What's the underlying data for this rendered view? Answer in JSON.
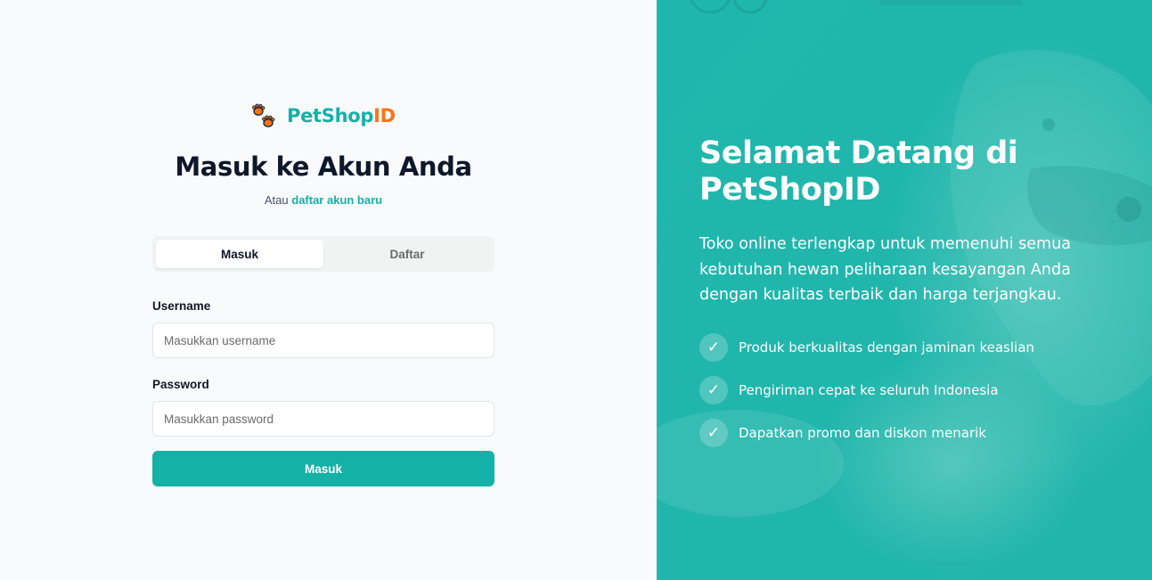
{
  "brand": {
    "name_part1": "PetShop",
    "name_part2": "ID",
    "logo_icon": "paw-prints-icon",
    "primary_color": "#14b1a7",
    "accent_color": "#f97316"
  },
  "login": {
    "title": "Masuk ke Akun Anda",
    "subtitle_prefix": "Atau",
    "subtitle_link": "daftar akun baru",
    "tabs": [
      {
        "label": "Masuk",
        "active": true
      },
      {
        "label": "Daftar",
        "active": false
      }
    ],
    "username_label": "Username",
    "username_placeholder": "Masukkan username",
    "username_value": "",
    "password_label": "Password",
    "password_placeholder": "Masukkan password",
    "password_value": "",
    "submit_label": "Masuk"
  },
  "hero": {
    "title": "Selamat Datang di PetShopID",
    "description": "Toko online terlengkap untuk memenuhi semua kebutuhan hewan peliharaan kesayangan Anda dengan kualitas terbaik dan harga terjangkau.",
    "check_icon": "checkmark-icon",
    "features": [
      {
        "icon": "✓",
        "text": "Produk berkualitas dengan jaminan keaslian"
      },
      {
        "icon": "✓",
        "text": "Pengiriman cepat ke seluruh Indonesia"
      },
      {
        "icon": "✓",
        "text": "Dapatkan promo dan diskon menarik"
      }
    ],
    "overlay_color": "#21b6ac"
  }
}
